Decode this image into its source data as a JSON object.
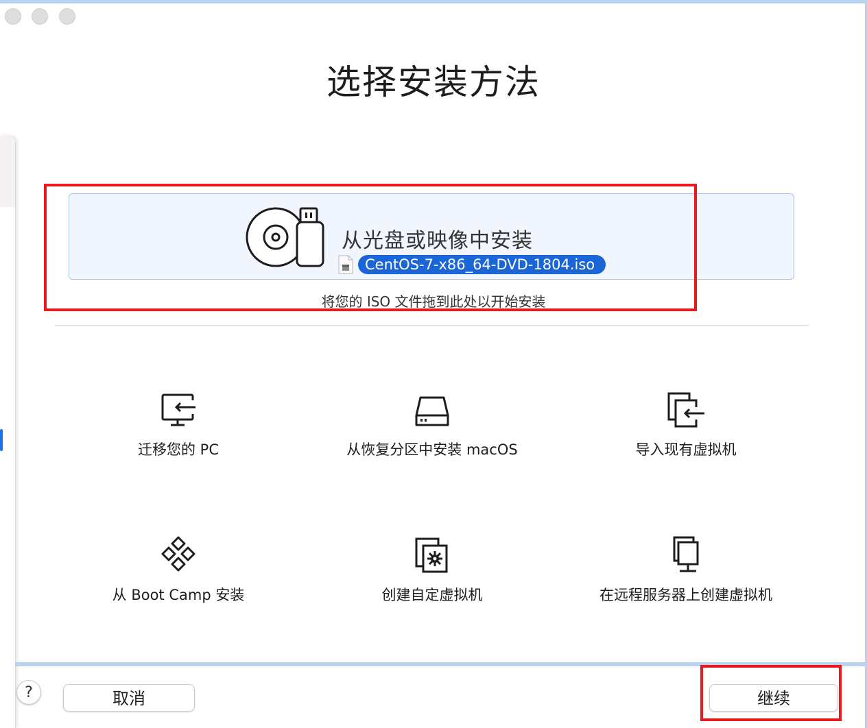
{
  "window": {
    "title": "选择安装方法",
    "traffic_lights": [
      "close",
      "minimize",
      "zoom"
    ]
  },
  "primary_option": {
    "label": "从光盘或映像中安装",
    "icon": "disc-usb-icon",
    "selected_file": "CentOS-7-x86_64-DVD-1804.iso",
    "file_icon": "document-icon",
    "hint": "将您的 ISO 文件拖到此处以开始安装"
  },
  "options": [
    {
      "label": "迁移您的 PC",
      "icon": "migrate-pc-icon"
    },
    {
      "label": "从恢复分区中安装 macOS",
      "icon": "hard-drive-icon"
    },
    {
      "label": "导入现有虚拟机",
      "icon": "import-vm-icon"
    },
    {
      "label": "从 Boot Camp 安装",
      "icon": "boot-camp-icon"
    },
    {
      "label": "创建自定虚拟机",
      "icon": "custom-vm-icon"
    },
    {
      "label": "在远程服务器上创建虚拟机",
      "icon": "remote-server-icon"
    }
  ],
  "footer": {
    "help_label": "?",
    "cancel_label": "取消",
    "continue_label": "继续"
  },
  "colors": {
    "accent": "#1a66d6",
    "highlight_border": "#e8191f",
    "drop_zone_bg": "#f1f5fd",
    "drop_zone_border": "#a9c4ec"
  }
}
